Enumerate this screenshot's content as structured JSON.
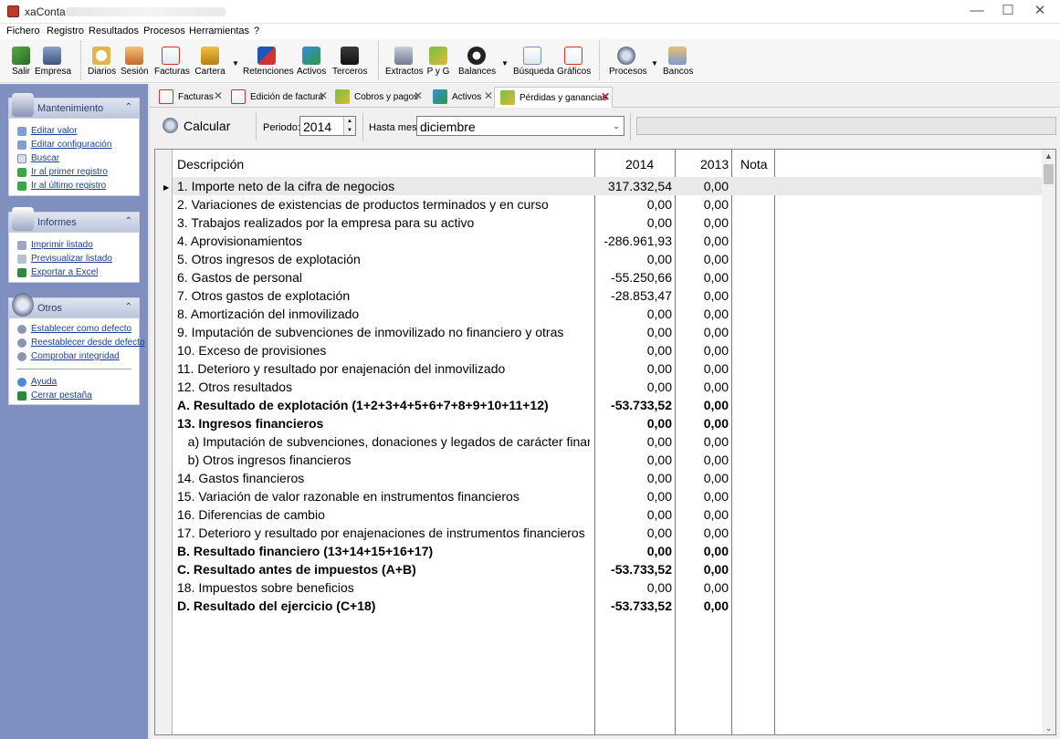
{
  "window": {
    "title": "xaConta -",
    "controls": {
      "minimize": "—",
      "maximize": "☐",
      "close": "✕"
    }
  },
  "menu": [
    "Fichero",
    "Registro",
    "Resultados",
    "Procesos",
    "Herramientas",
    "?"
  ],
  "toolbar": {
    "salir": "Salir",
    "empresa": "Empresa",
    "diarios": "Diarios",
    "sesion": "Sesión",
    "facturas": "Facturas",
    "cartera": "Cartera",
    "retenciones": "Retenciones",
    "activos": "Activos",
    "terceros": "Terceros",
    "extractos": "Extractos",
    "pyg": "P y G",
    "balances": "Balances",
    "busqueda": "Búsqueda",
    "graficos": "Gráficos",
    "procesos": "Procesos",
    "bancos": "Bancos",
    "dropdown_arrow": "▼"
  },
  "sidebar": {
    "mantenimiento": {
      "title": "Mantenimiento",
      "items": [
        "Editar valor",
        "Editar configuración",
        "Buscar",
        "Ir al primer registro",
        "Ir al último registro"
      ]
    },
    "informes": {
      "title": "Informes",
      "items": [
        "Imprimir listado",
        "Previsualizar listado",
        "Exportar a Excel"
      ]
    },
    "otros": {
      "title": "Otros",
      "items": [
        "Establecer como defecto",
        "Reestablecer desde defecto",
        "Comprobar integridad"
      ],
      "items2": [
        "Ayuda",
        "Cerrar pestaña"
      ]
    },
    "collapse_glyph": "⌃"
  },
  "tabs": [
    {
      "label": "Facturas",
      "close": "✕"
    },
    {
      "label": "Edición de factura",
      "close": "✕"
    },
    {
      "label": "Cobros y pagos",
      "close": "✕"
    },
    {
      "label": "Activos",
      "close": "✕"
    },
    {
      "label": "Pérdidas y ganancias",
      "close": "✕"
    }
  ],
  "params": {
    "calc_label": "Calcular",
    "periodo_label": "Periodo:",
    "periodo_value": "2014",
    "hasta_label": "Hasta mes:",
    "hasta_value": "diciembre",
    "spin_up": "▲",
    "spin_down": "▼",
    "combo_arrow": "⌄"
  },
  "grid": {
    "columns": [
      "Descripción",
      "2014",
      "2013",
      "Nota"
    ],
    "row_marker": "▶",
    "rows": [
      {
        "desc": "1. Importe neto de la cifra de negocios",
        "v2014": "317.332,54",
        "v2013": "0,00",
        "bold": false
      },
      {
        "desc": "2. Variaciones de existencias de productos terminados y en curso",
        "v2014": "0,00",
        "v2013": "0,00",
        "bold": false
      },
      {
        "desc": "3. Trabajos realizados por la empresa para su activo",
        "v2014": "0,00",
        "v2013": "0,00",
        "bold": false
      },
      {
        "desc": "4. Aprovisionamientos",
        "v2014": "-286.961,93",
        "v2013": "0,00",
        "bold": false
      },
      {
        "desc": "5. Otros ingresos de explotación",
        "v2014": "0,00",
        "v2013": "0,00",
        "bold": false
      },
      {
        "desc": "6. Gastos de personal",
        "v2014": "-55.250,66",
        "v2013": "0,00",
        "bold": false
      },
      {
        "desc": "7. Otros gastos de explotación",
        "v2014": "-28.853,47",
        "v2013": "0,00",
        "bold": false
      },
      {
        "desc": "8. Amortización del inmovilizado",
        "v2014": "0,00",
        "v2013": "0,00",
        "bold": false
      },
      {
        "desc": "9. Imputación de subvenciones de inmovilizado no financiero y otras",
        "v2014": "0,00",
        "v2013": "0,00",
        "bold": false
      },
      {
        "desc": "10. Exceso de provisiones",
        "v2014": "0,00",
        "v2013": "0,00",
        "bold": false
      },
      {
        "desc": "11. Deterioro y resultado por enajenación del inmovilizado",
        "v2014": "0,00",
        "v2013": "0,00",
        "bold": false
      },
      {
        "desc": "12. Otros resultados",
        "v2014": "0,00",
        "v2013": "0,00",
        "bold": false
      },
      {
        "desc": "A. Resultado de explotación (1+2+3+4+5+6+7+8+9+10+11+12)",
        "v2014": "-53.733,52",
        "v2013": "0,00",
        "bold": true
      },
      {
        "desc": "13. Ingresos financieros",
        "v2014": "0,00",
        "v2013": "0,00",
        "bold": true
      },
      {
        "desc": "   a) Imputación de subvenciones, donaciones y legados de carácter financier",
        "v2014": "0,00",
        "v2013": "0,00",
        "bold": false
      },
      {
        "desc": "   b) Otros ingresos financieros",
        "v2014": "0,00",
        "v2013": "0,00",
        "bold": false
      },
      {
        "desc": "14. Gastos financieros",
        "v2014": "0,00",
        "v2013": "0,00",
        "bold": false
      },
      {
        "desc": "15. Variación de valor razonable en instrumentos financieros",
        "v2014": "0,00",
        "v2013": "0,00",
        "bold": false
      },
      {
        "desc": "16. Diferencias de cambio",
        "v2014": "0,00",
        "v2013": "0,00",
        "bold": false
      },
      {
        "desc": "17. Deterioro y resultado por enajenaciones de instrumentos financieros",
        "v2014": "0,00",
        "v2013": "0,00",
        "bold": false
      },
      {
        "desc": "B. Resultado financiero (13+14+15+16+17)",
        "v2014": "0,00",
        "v2013": "0,00",
        "bold": true
      },
      {
        "desc": "C. Resultado antes de impuestos (A+B)",
        "v2014": "-53.733,52",
        "v2013": "0,00",
        "bold": true
      },
      {
        "desc": "18. Impuestos sobre beneficios",
        "v2014": "0,00",
        "v2013": "0,00",
        "bold": false
      },
      {
        "desc": "D. Resultado del ejercicio (C+18)",
        "v2014": "-53.733,52",
        "v2013": "0,00",
        "bold": true
      }
    ],
    "scroll_up": "▲",
    "scroll_down": "⌄"
  }
}
